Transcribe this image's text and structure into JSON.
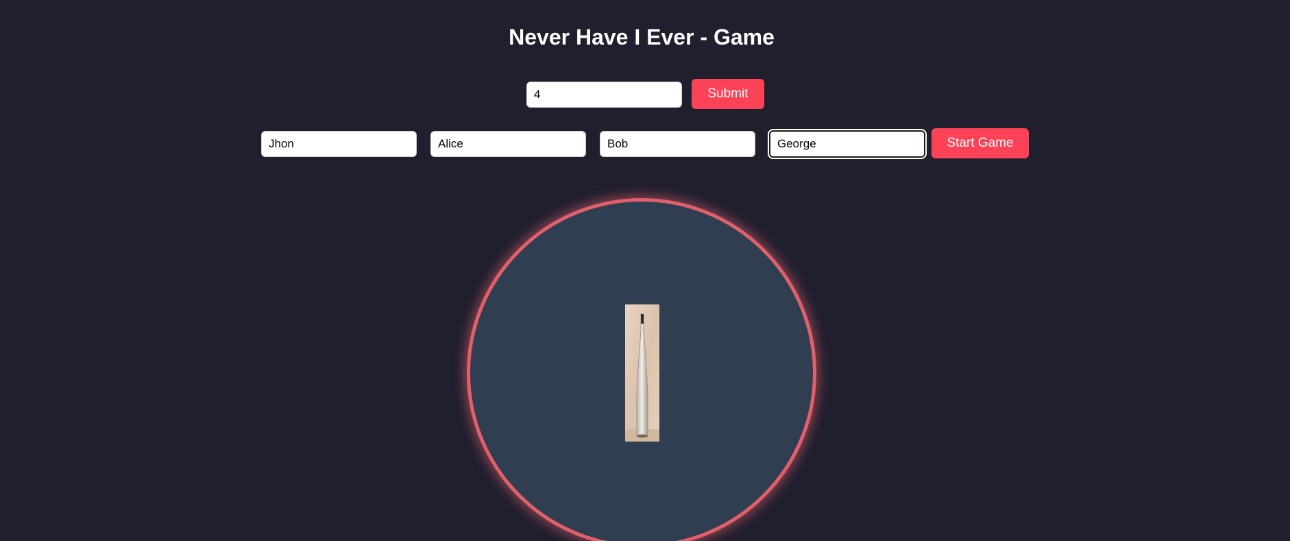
{
  "header": {
    "title": "Never Have I Ever - Game"
  },
  "player_count_form": {
    "value": "4",
    "submit_label": "Submit"
  },
  "players": {
    "names": [
      "Jhon",
      "Alice",
      "Bob",
      "George"
    ],
    "start_label": "Start Game"
  },
  "wheel": {
    "bottle_icon": "bottle-image"
  },
  "colors": {
    "background": "#201f2e",
    "accent": "#fc4257",
    "wheel_fill": "#2f3e50",
    "wheel_border": "#e2606c"
  }
}
